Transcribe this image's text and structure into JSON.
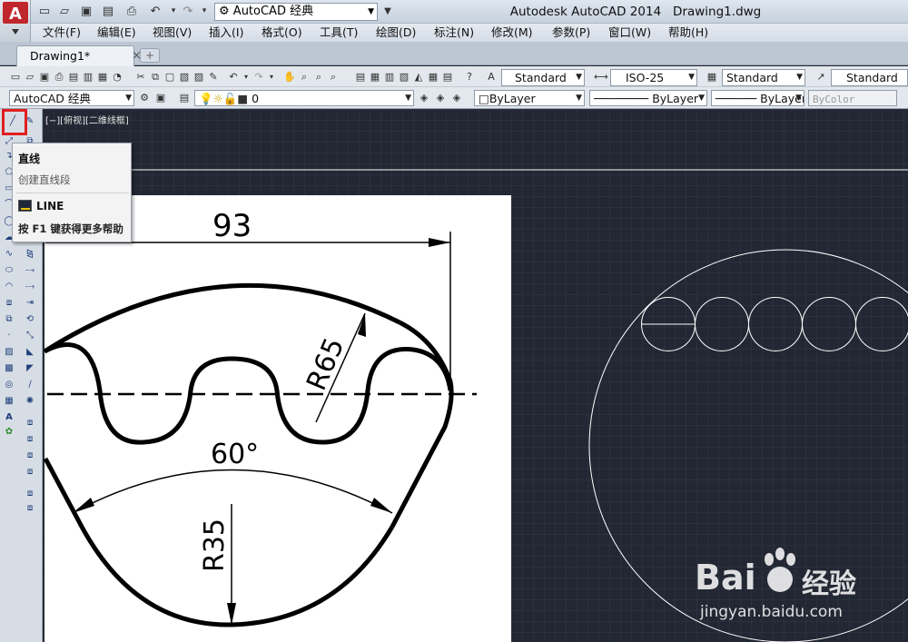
{
  "window": {
    "title": "Autodesk AutoCAD 2014",
    "document": "Drawing1.dwg",
    "workspace": "AutoCAD 经典",
    "app_logo": "A"
  },
  "menu": [
    "文件(F)",
    "编辑(E)",
    "视图(V)",
    "插入(I)",
    "格式(O)",
    "工具(T)",
    "绘图(D)",
    "标注(N)",
    "修改(M)",
    "参数(P)",
    "窗口(W)",
    "帮助(H)"
  ],
  "tabs": {
    "active": "Drawing1*",
    "close": "×",
    "new": "+"
  },
  "toolbar_styles": {
    "text_style": "Standard",
    "dim_style": "ISO-25",
    "table_style": "Standard",
    "multileader_style": "Standard"
  },
  "toolbar_layers": {
    "workspace": "AutoCAD 经典",
    "layer": "0",
    "color": "ByLayer",
    "linetype": "ByLayer",
    "lineweight": "ByLayer",
    "plotstyle": "ByColor"
  },
  "viewport": {
    "label": "[−][俯视][二维线框]"
  },
  "tooltip": {
    "title": "直线",
    "description": "创建直线段",
    "command": "LINE",
    "help": "按 F1 键获得更多帮助"
  },
  "reference_drawing": {
    "dim_width": "93",
    "dim_radius_outer": "R65",
    "dim_angle": "60°",
    "dim_radius_inner": "R35"
  },
  "watermark": {
    "brand": "Bai",
    "brand2": "经验",
    "url": "jingyan.baidu.com"
  },
  "colors": {
    "canvas": "#222733",
    "highlight": "#e02020",
    "cad_line": "#ffffff"
  }
}
